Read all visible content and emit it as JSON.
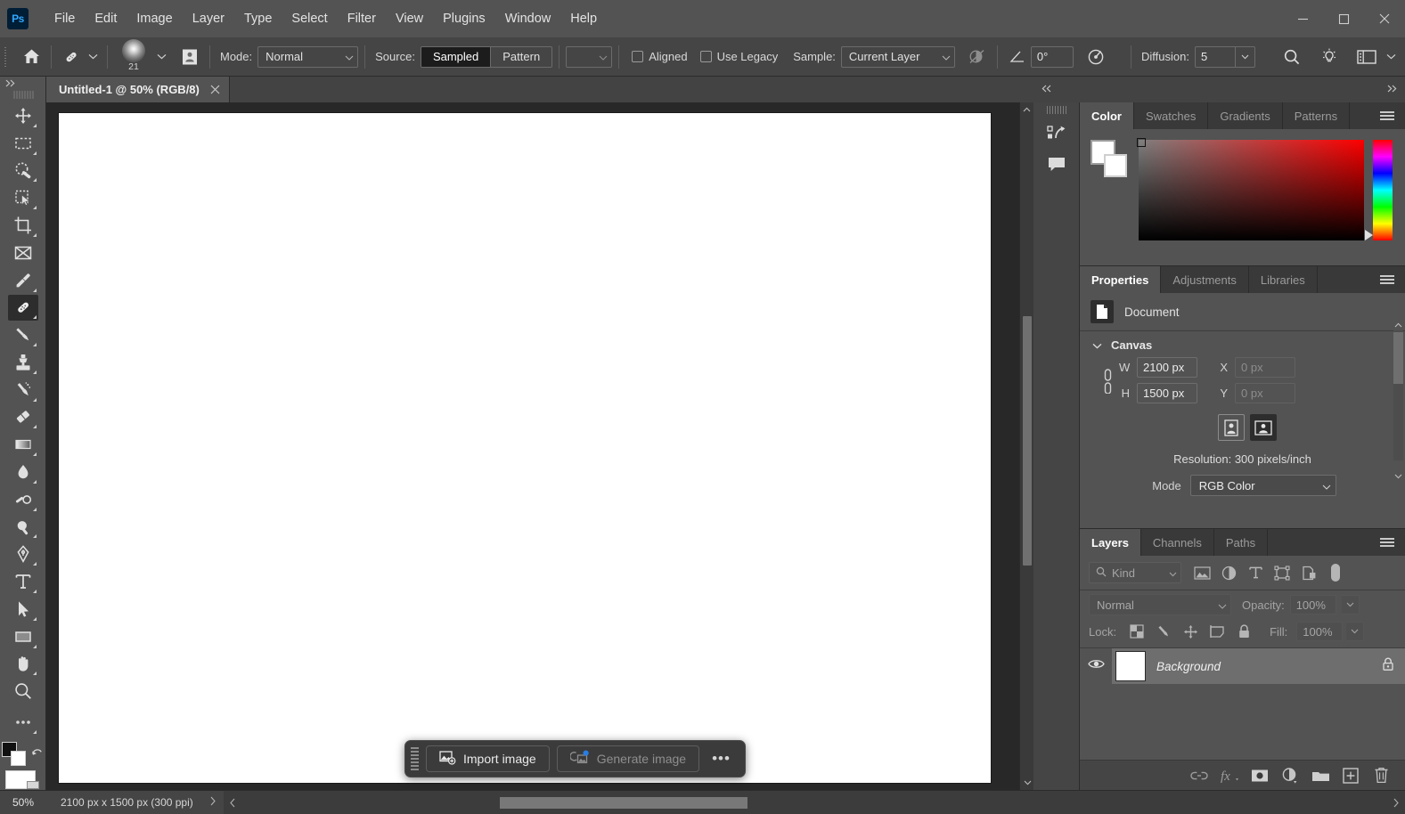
{
  "app": {
    "logo": "Ps",
    "menus": [
      "File",
      "Edit",
      "Image",
      "Layer",
      "Type",
      "Select",
      "Filter",
      "View",
      "Plugins",
      "Window",
      "Help"
    ],
    "window_controls": [
      "minimize",
      "maximize",
      "close"
    ]
  },
  "options_bar": {
    "home_icon": "home-icon",
    "tool_icon": "healing-brush-icon",
    "brush_size": "21",
    "brush_preset_icon": "brush-preset-picker-icon",
    "pattern_icon": "pattern-stamp-icon",
    "mode_label": "Mode:",
    "mode_value": "Normal",
    "source_label": "Source:",
    "source_options": [
      "Sampled",
      "Pattern"
    ],
    "source_selected": "Sampled",
    "aligned_label": "Aligned",
    "aligned_checked": false,
    "use_legacy_label": "Use Legacy",
    "use_legacy_checked": false,
    "sample_label": "Sample:",
    "sample_value": "Current Layer",
    "ignore_adjustment_icon": "ignore-adjustment-layers-icon",
    "angle_icon": "angle-icon",
    "angle_value": "0°",
    "pressure_icon": "pressure-for-size-icon",
    "diffusion_label": "Diffusion:",
    "diffusion_value": "5",
    "search_icon": "search-icon",
    "discover_icon": "discover-lightbulb-icon",
    "workspace_icon": "workspace-switcher-icon",
    "overflow_icon": "chevron-down-icon"
  },
  "document_tab": {
    "title": "Untitled-1 @ 50% (RGB/8)",
    "close_icon": "close-icon"
  },
  "toolbar": {
    "collapse_icon": "expand-toolbar-icon",
    "tools": [
      {
        "name": "move-tool",
        "icon": "move-icon",
        "active": false
      },
      {
        "name": "rectangular-marquee-tool",
        "icon": "marquee-icon",
        "active": false
      },
      {
        "name": "lasso-tool",
        "icon": "lasso-icon",
        "active": false
      },
      {
        "name": "object-selection-tool",
        "icon": "object-select-icon",
        "active": false
      },
      {
        "name": "crop-tool",
        "icon": "crop-icon",
        "active": false
      },
      {
        "name": "frame-tool",
        "icon": "frame-icon",
        "active": false
      },
      {
        "name": "eyedropper-tool",
        "icon": "eyedropper-icon",
        "active": false
      },
      {
        "name": "healing-brush-tool",
        "icon": "healing-brush-icon",
        "active": true
      },
      {
        "name": "brush-tool",
        "icon": "brush-icon",
        "active": false
      },
      {
        "name": "clone-stamp-tool",
        "icon": "clone-stamp-icon",
        "active": false
      },
      {
        "name": "history-brush-tool",
        "icon": "history-brush-icon",
        "active": false
      },
      {
        "name": "eraser-tool",
        "icon": "eraser-icon",
        "active": false
      },
      {
        "name": "gradient-tool",
        "icon": "gradient-icon",
        "active": false
      },
      {
        "name": "blur-tool",
        "icon": "blur-droplet-icon",
        "active": false
      },
      {
        "name": "dodge-tool",
        "icon": "dodge-icon",
        "active": false
      },
      {
        "name": "burn-tool",
        "icon": "burn-icon",
        "active": false
      },
      {
        "name": "pen-tool",
        "icon": "pen-icon",
        "active": false
      },
      {
        "name": "type-tool",
        "icon": "type-t-icon",
        "active": false
      },
      {
        "name": "path-selection-tool",
        "icon": "path-arrow-icon",
        "active": false
      },
      {
        "name": "rectangle-tool",
        "icon": "rectangle-icon",
        "active": false
      },
      {
        "name": "hand-tool",
        "icon": "hand-icon",
        "active": false
      },
      {
        "name": "zoom-tool",
        "icon": "zoom-magnifier-icon",
        "active": false
      },
      {
        "name": "edit-toolbar",
        "icon": "more-dots-icon",
        "active": false
      }
    ],
    "foreground_color": "#000000",
    "background_color": "#ffffff",
    "swap_icon": "swap-colors-icon",
    "quickmask_icon": "quick-mask-icon"
  },
  "canvas": {
    "background_color": "#282828",
    "artboard_color": "#ffffff",
    "vscroll": "vertical-scrollbar"
  },
  "contextual_taskbar": {
    "grip": "drag-handle",
    "import_label": "Import image",
    "import_icon": "import-image-icon",
    "generate_label": "Generate image",
    "generate_icon": "generate-image-icon",
    "generate_disabled": true,
    "more_label": "•••"
  },
  "right_dock": {
    "collapse_icon": "collapse-panels-icon",
    "expand_icon": "expand-panels-icon",
    "mini_buttons": [
      {
        "name": "history-panel-icon"
      },
      {
        "name": "comments-panel-icon"
      }
    ]
  },
  "color_panel": {
    "tabs": [
      "Color",
      "Swatches",
      "Gradients",
      "Patterns"
    ],
    "active_tab": "Color",
    "menu_icon": "panel-menu-icon",
    "foreground": "#ffffff",
    "background": "#ffffff",
    "spectrum": "ramp-red",
    "hue_pointer": "hue-slider-handle"
  },
  "properties_panel": {
    "tabs": [
      "Properties",
      "Adjustments",
      "Libraries"
    ],
    "active_tab": "Properties",
    "menu_icon": "panel-menu-icon",
    "doc_icon": "document-icon",
    "doc_label": "Document",
    "section_title": "Canvas",
    "section_chevron": "chevron-down-icon",
    "link_icon": "link-dimensions-icon",
    "fields": [
      {
        "label": "W",
        "value": "2100 px",
        "muted": false
      },
      {
        "label": "H",
        "value": "1500 px",
        "muted": false
      },
      {
        "label": "X",
        "value": "0 px",
        "muted": true
      },
      {
        "label": "Y",
        "value": "0 px",
        "muted": true
      }
    ],
    "orientation": [
      {
        "name": "portrait-orientation-button",
        "selected": false
      },
      {
        "name": "landscape-orientation-button",
        "selected": true
      }
    ],
    "resolution_text": "Resolution: 300 pixels/inch",
    "mode_label": "Mode",
    "mode_value": "RGB Color"
  },
  "layers_panel": {
    "tabs": [
      "Layers",
      "Channels",
      "Paths"
    ],
    "active_tab": "Layers",
    "menu_icon": "panel-menu-icon",
    "filter_kind": "Kind",
    "filter_search_icon": "search-icon",
    "filter_icons": [
      "filter-pixel-icon",
      "filter-adjustment-icon",
      "filter-type-icon",
      "filter-shape-icon",
      "filter-smart-object-icon",
      "filter-toggle-icon"
    ],
    "blend_mode": "Normal",
    "opacity_label": "Opacity:",
    "opacity_value": "100%",
    "lock_label": "Lock:",
    "lock_icons": [
      "lock-transparency-icon",
      "lock-image-icon",
      "lock-position-icon",
      "lock-artboard-nesting-icon",
      "lock-all-icon"
    ],
    "fill_label": "Fill:",
    "fill_value": "100%",
    "layers": [
      {
        "name": "Background",
        "visible": true,
        "locked": true,
        "selected": true,
        "thumb_color": "#ffffff",
        "eye_icon": "eye-icon",
        "lock_icon": "lock-icon"
      }
    ],
    "bottom_buttons": [
      "link-layers-icon",
      "layer-styles-fx-icon",
      "add-layer-mask-icon",
      "new-adjustment-layer-icon",
      "new-group-icon",
      "new-layer-icon",
      "delete-layer-icon"
    ]
  },
  "status_bar": {
    "zoom": "50%",
    "dimensions": "2100 px x 1500 px (300 ppi)",
    "expand_icon": "chevron-right-icon",
    "scroll_left_icon": "chevron-left-icon",
    "scroll_right_icon": "chevron-right-icon"
  }
}
